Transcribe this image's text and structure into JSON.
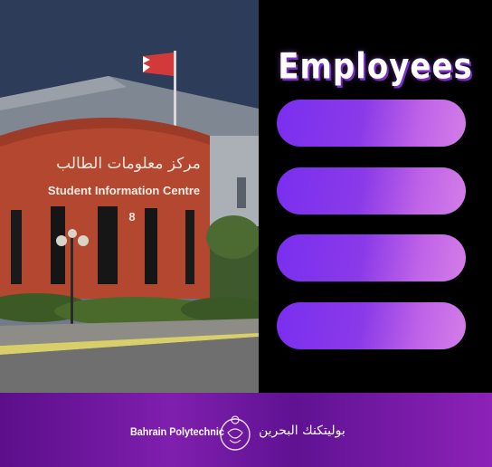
{
  "photo": {
    "sign_arabic": "مركز معلومات الطالب",
    "sign_english": "Student Information Centre",
    "building_number": "8"
  },
  "panel": {
    "title": "Employees",
    "buttons": [
      {
        "label": ""
      },
      {
        "label": ""
      },
      {
        "label": ""
      },
      {
        "label": ""
      }
    ]
  },
  "footer": {
    "brand_english": "Bahrain Polytechnic",
    "brand_arabic": "بوليتكنك البحرين",
    "logo_icon": "polytechnic-logo-icon"
  },
  "colors": {
    "panel_background": "#000000",
    "button_start": "#7a2ff0",
    "button_end": "#d37ee8",
    "footer": "#7f1fae",
    "brick": "#b4472f"
  }
}
